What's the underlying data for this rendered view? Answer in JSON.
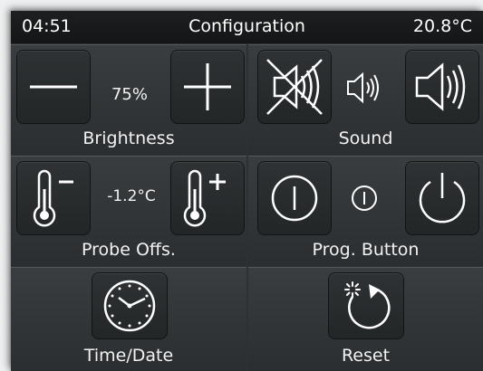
{
  "status": {
    "time": "04:51",
    "title": "Configuration",
    "temperature": "20.8°C"
  },
  "brightness": {
    "label": "Brightness",
    "value": "75%",
    "decrease_icon": "minus-icon",
    "increase_icon": "plus-icon"
  },
  "sound": {
    "label": "Sound",
    "mute_icon": "speaker-muted-icon",
    "level_icon": "speaker-low-icon",
    "louder_icon": "speaker-loud-icon"
  },
  "probe_offset": {
    "label": "Probe Offs.",
    "value": "-1.2°C",
    "decrease_icon": "thermometer-minus-icon",
    "increase_icon": "thermometer-plus-icon"
  },
  "prog_button": {
    "label": "Prog. Button",
    "left_icon": "power-line-icon",
    "mid_icon": "power-line-small-icon",
    "right_icon": "power-icon"
  },
  "time_date": {
    "label": "Time/Date",
    "icon": "clock-icon"
  },
  "reset": {
    "label": "Reset",
    "icon": "reset-icon"
  },
  "colors": {
    "background": "#2e3133",
    "status_bar": "#141516",
    "text": "#ffffff"
  }
}
